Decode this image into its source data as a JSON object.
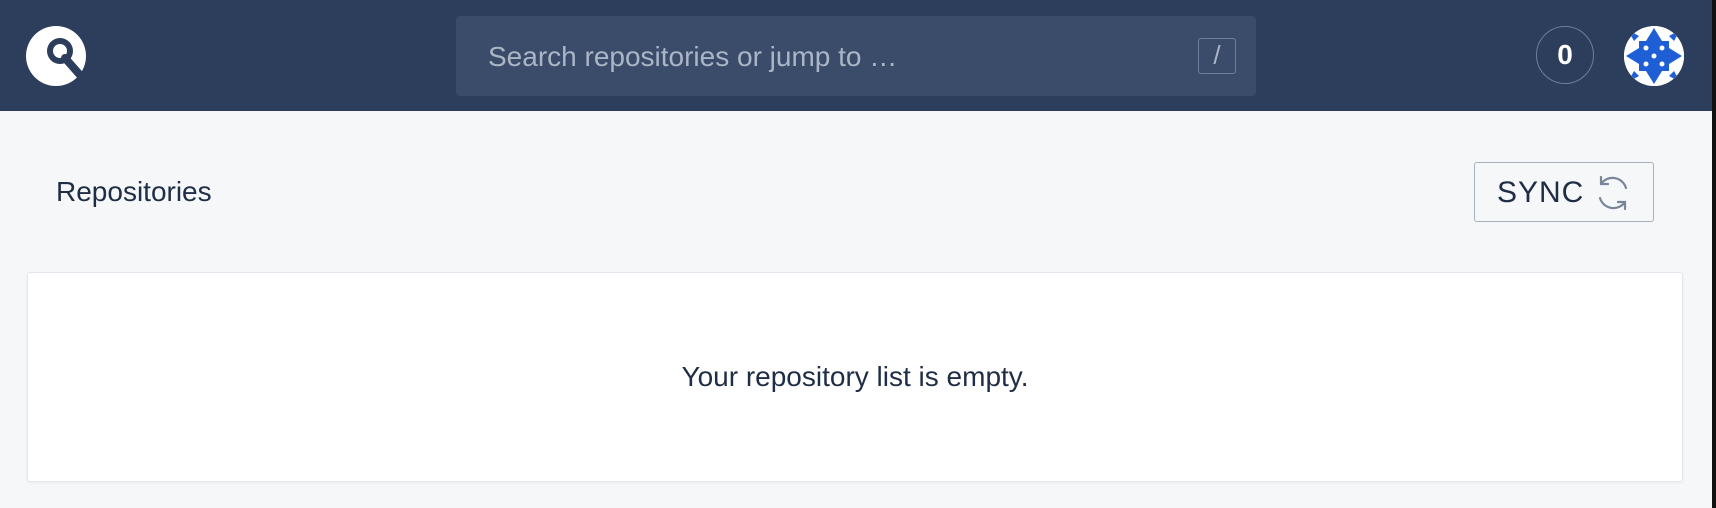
{
  "header": {
    "logo_icon": "drone-logo-icon",
    "search": {
      "placeholder": "Search repositories or jump to …",
      "value": "",
      "shortcut_key": "/"
    },
    "notifications": {
      "count": "0"
    },
    "avatar_icon": "user-avatar-icon"
  },
  "main": {
    "title": "Repositories",
    "sync_button": {
      "label": "SYNC",
      "icon": "refresh-icon"
    },
    "empty_message": "Your repository list is empty."
  },
  "colors": {
    "header_bg": "#2c3e5c",
    "search_bg": "#3b4c6a",
    "page_bg": "#f5f7f9",
    "text": "#1f2d46",
    "avatar_accent": "#1f5fd6"
  }
}
